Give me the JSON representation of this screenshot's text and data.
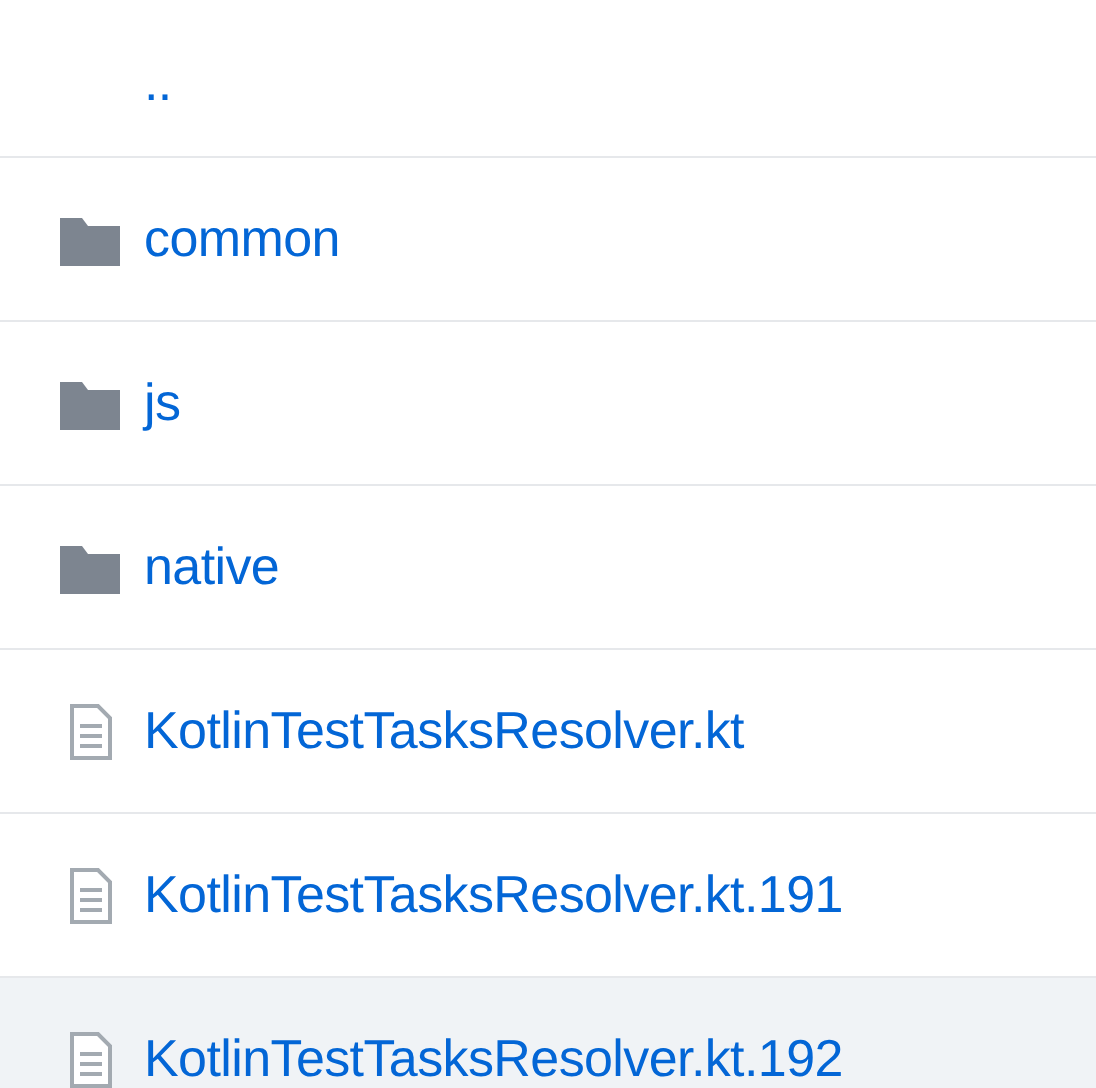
{
  "entries": [
    {
      "kind": "parent",
      "name": "..",
      "selected": false
    },
    {
      "kind": "dir",
      "name": "common",
      "selected": false
    },
    {
      "kind": "dir",
      "name": "js",
      "selected": false
    },
    {
      "kind": "dir",
      "name": "native",
      "selected": false
    },
    {
      "kind": "file",
      "name": "KotlinTestTasksResolver.kt",
      "selected": false
    },
    {
      "kind": "file",
      "name": "KotlinTestTasksResolver.kt.191",
      "selected": false
    },
    {
      "kind": "file",
      "name": "KotlinTestTasksResolver.kt.192",
      "selected": true
    }
  ]
}
